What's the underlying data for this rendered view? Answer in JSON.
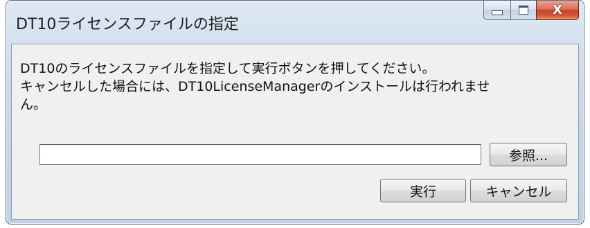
{
  "window": {
    "title": "DT10ライセンスファイルの指定",
    "close_glyph": "X"
  },
  "message": {
    "line1": "DT10のライセンスファイルを指定して実行ボタンを押してください。",
    "line2": "キャンセルした場合には、DT10LicenseManagerのインストールは行われませ",
    "line3": "ん。"
  },
  "file_field": {
    "value": "",
    "placeholder": ""
  },
  "buttons": {
    "browse_label": "参照...",
    "run_label": "実行",
    "cancel_label": "キャンセル"
  },
  "icons": {
    "minimize": "minimize-icon",
    "maximize": "maximize-icon",
    "close": "close-icon"
  },
  "colors": {
    "close_button": "#c6432a",
    "frame": "#c6d5e8"
  }
}
